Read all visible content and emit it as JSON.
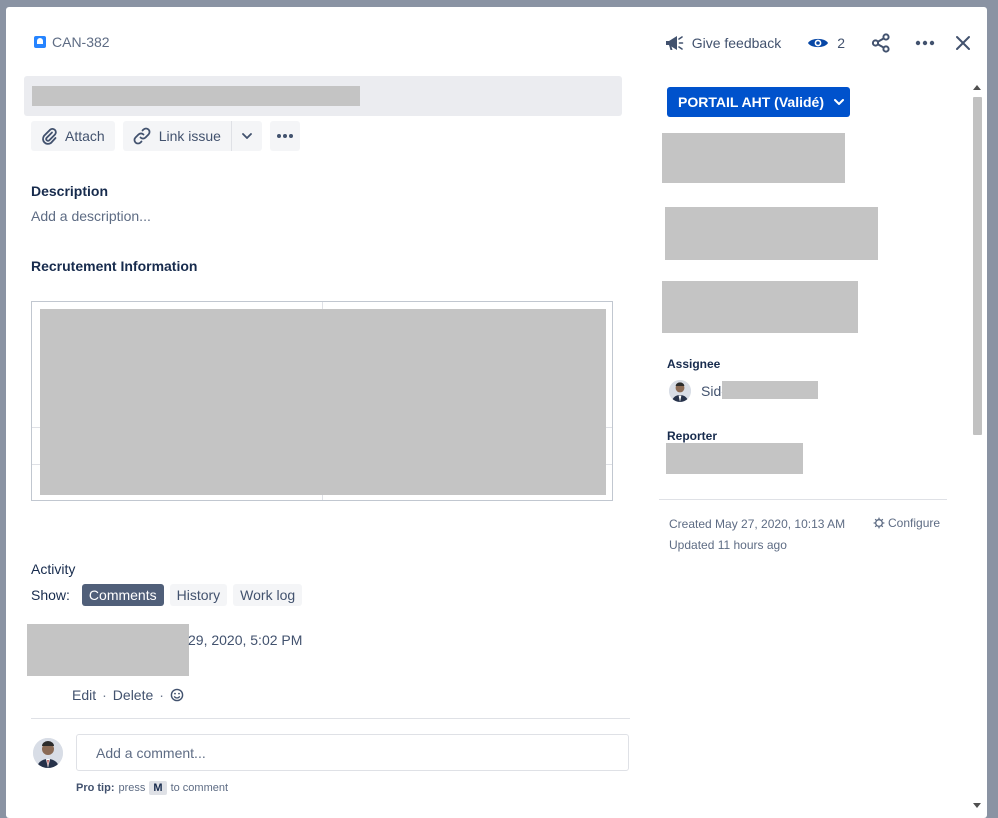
{
  "header": {
    "issue_key": "CAN-382",
    "feedback_label": "Give feedback",
    "watch_count": "2"
  },
  "toolbar": {
    "attach_label": "Attach",
    "link_issue_label": "Link issue"
  },
  "description": {
    "title": "Description",
    "placeholder": "Add a description..."
  },
  "recrutement": {
    "title": "Recrutement Information"
  },
  "activity": {
    "title": "Activity",
    "show_label": "Show:",
    "tabs": [
      "Comments",
      "History",
      "Work log"
    ],
    "comment": {
      "date": "29, 2020, 5:02 PM",
      "edit_label": "Edit",
      "delete_label": "Delete"
    },
    "add_comment_placeholder": "Add a comment...",
    "protip_prefix": "Pro tip:",
    "protip_press": "press",
    "protip_key": "M",
    "protip_suffix": "to comment"
  },
  "sidebar": {
    "status_label": "PORTAIL AHT (Validé)",
    "assignee_label": "Assignee",
    "assignee_name": "Sid-",
    "reporter_label": "Reporter",
    "created_text": "Created May 27, 2020, 10:13 AM",
    "updated_text": "Updated 11 hours ago",
    "configure_label": "Configure"
  },
  "icons": {
    "issue_type": "story-icon",
    "feedback": "megaphone-icon",
    "watch": "eye-icon",
    "share": "share-icon",
    "more": "more-icon",
    "close": "close-icon",
    "attach": "paperclip-icon",
    "link": "link-icon",
    "configure": "gear-icon",
    "emoji": "emoji-icon"
  },
  "colors": {
    "primary": "#0052cc",
    "backdrop": "#8a93a3",
    "active_tab": "#505f79"
  }
}
